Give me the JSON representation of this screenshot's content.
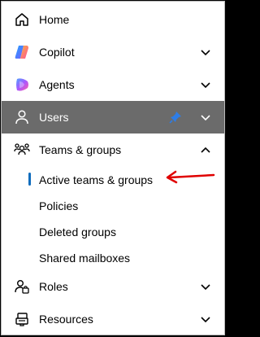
{
  "nav": {
    "items": [
      {
        "label": "Home",
        "icon": "home-icon"
      },
      {
        "label": "Copilot",
        "icon": "copilot-icon"
      },
      {
        "label": "Agents",
        "icon": "agents-icon"
      },
      {
        "label": "Users",
        "icon": "user-icon",
        "selected": true,
        "pinned": true
      },
      {
        "label": "Teams & groups",
        "icon": "teams-groups-icon",
        "expanded": true
      }
    ],
    "sub_items": [
      {
        "label": "Active teams & groups",
        "active": true
      },
      {
        "label": "Policies"
      },
      {
        "label": "Deleted groups"
      },
      {
        "label": "Shared mailboxes"
      }
    ],
    "bottom_items": [
      {
        "label": "Roles",
        "icon": "roles-icon"
      },
      {
        "label": "Resources",
        "icon": "resources-icon"
      }
    ]
  },
  "colors": {
    "selected_bg": "#6b6b6b",
    "pin": "#2e7de6",
    "active_indicator": "#0f6cbd",
    "annotation_arrow": "#e00000"
  }
}
